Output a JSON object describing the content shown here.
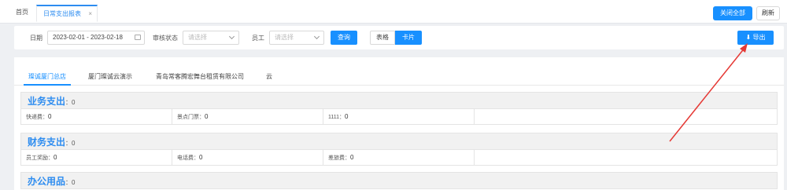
{
  "tabs": {
    "home": "首页",
    "active": "日常支出报表",
    "close_glyph": "×"
  },
  "topbar": {
    "close_all": "关闭全部",
    "refresh": "刷新"
  },
  "filter": {
    "date_label": "日期",
    "date_value": "2023-02-01 - 2023-02-18",
    "status_label": "审核状态",
    "status_placeholder": "请选择",
    "employee_label": "员工",
    "employee_placeholder": "请选择",
    "query": "查询",
    "view_table": "表格",
    "view_card": "卡片",
    "export": "导出"
  },
  "company_tabs": [
    "璨诚厦门总店",
    "厦门璨诚云演示",
    "青岛常客腾宏舞台租赁有限公司",
    "云"
  ],
  "sections": [
    {
      "title": "业务支出",
      "total": "：0",
      "items": [
        {
          "label": "快递费：",
          "value": "0"
        },
        {
          "label": "景点门票：",
          "value": "0"
        },
        {
          "label": "1111：",
          "value": "0"
        }
      ]
    },
    {
      "title": "财务支出",
      "total": "：0",
      "items": [
        {
          "label": "员工奖励：",
          "value": "0"
        },
        {
          "label": "电话费：",
          "value": "0"
        },
        {
          "label": "差旅费：",
          "value": "0"
        }
      ]
    },
    {
      "title": "办公用品",
      "total": "：0",
      "items": []
    }
  ],
  "colors": {
    "accent": "#1890ff",
    "annotation": "#e53935"
  }
}
